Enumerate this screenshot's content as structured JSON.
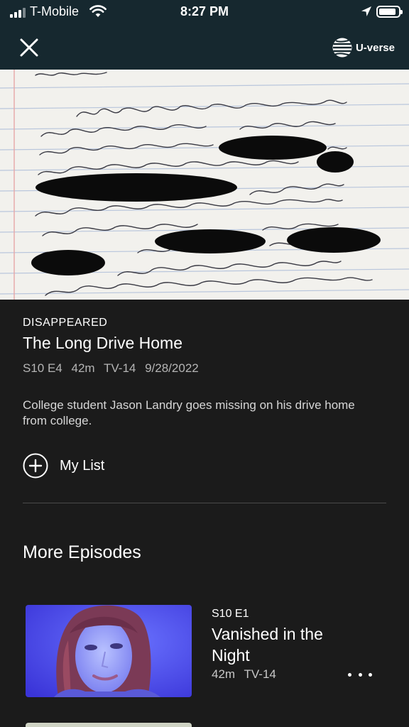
{
  "status_bar": {
    "carrier": "T-Mobile",
    "time": "8:27 PM",
    "battery_level": 0.9
  },
  "nav": {
    "brand": "U-verse",
    "close_icon": "close-icon",
    "brand_icon": "att-globe-icon"
  },
  "details": {
    "show": "DISAPPEARED",
    "title": "The Long Drive Home",
    "season_episode": "S10 E4",
    "duration": "42m",
    "rating": "TV-14",
    "air_date": "9/28/2022",
    "description": "College student Jason Landry goes missing on his drive home from college.",
    "my_list_label": "My List",
    "my_list_icon": "plus-circle-icon"
  },
  "more_episodes": {
    "heading": "More Episodes",
    "items": [
      {
        "season_episode": "S10 E1",
        "title": "Vanished in the Night",
        "duration": "42m",
        "rating": "TV-14",
        "more_icon": "more-options-icon"
      }
    ]
  }
}
